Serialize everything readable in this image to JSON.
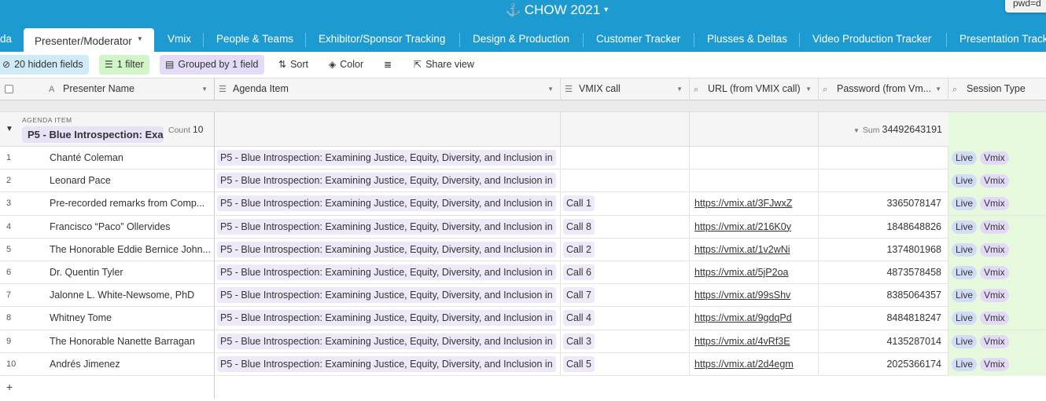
{
  "base": {
    "title": "CHOW 2021",
    "anchor_icon": "anchor-icon",
    "pwd_tooltip": "pwd=d"
  },
  "tabs": [
    {
      "label": "da"
    },
    {
      "label": "Presenter/Moderator",
      "active": true
    },
    {
      "label": "Vmix"
    },
    {
      "label": "People & Teams"
    },
    {
      "label": "Exhibitor/Sponsor Tracking"
    },
    {
      "label": "Design & Production"
    },
    {
      "label": "Customer Tracker"
    },
    {
      "label": "Plusses & Deltas"
    },
    {
      "label": "Video Production Tracker"
    },
    {
      "label": "Presentation Track"
    }
  ],
  "toolbar": {
    "hidden_fields": "20 hidden fields",
    "filter": "1 filter",
    "grouped": "Grouped by 1 field",
    "sort": "Sort",
    "color": "Color",
    "share": "Share view"
  },
  "columns": {
    "name": "Presenter Name",
    "agenda": "Agenda Item",
    "call": "VMIX call",
    "url": "URL (from VMIX call)",
    "password": "Password (from Vm...",
    "session": "Session Type"
  },
  "group": {
    "label": "AGENDA ITEM",
    "value": "P5 - Blue Introspection: Exa",
    "count_label": "Count",
    "count": "10",
    "sum_label": "Sum",
    "sum": "34492643191"
  },
  "rows": [
    {
      "num": "1",
      "name": "Chanté Coleman",
      "agenda": "P5 - Blue Introspection: Examining Justice, Equity, Diversity, and Inclusion in",
      "call": "",
      "url": "",
      "password": "",
      "tags": [
        "Live",
        "Vmix"
      ]
    },
    {
      "num": "2",
      "name": "Leonard Pace",
      "agenda": "P5 - Blue Introspection: Examining Justice, Equity, Diversity, and Inclusion in",
      "call": "",
      "url": "",
      "password": "",
      "tags": [
        "Live",
        "Vmix"
      ]
    },
    {
      "num": "3",
      "name": "Pre-recorded remarks from Comp...",
      "agenda": "P5 - Blue Introspection: Examining Justice, Equity, Diversity, and Inclusion in",
      "call": "Call 1",
      "url": "https://vmix.at/3FJwxZ",
      "password": "3365078147",
      "tags": [
        "Live",
        "Vmix"
      ]
    },
    {
      "num": "4",
      "name": "Francisco “Paco” Ollervides",
      "agenda": "P5 - Blue Introspection: Examining Justice, Equity, Diversity, and Inclusion in",
      "call": "Call 8",
      "url": "https://vmix.at/216K0y",
      "password": "1848648826",
      "tags": [
        "Live",
        "Vmix"
      ]
    },
    {
      "num": "5",
      "name": "The Honorable Eddie Bernice John...",
      "agenda": "P5 - Blue Introspection: Examining Justice, Equity, Diversity, and Inclusion in",
      "call": "Call 2",
      "url": "https://vmix.at/1v2wNi",
      "password": "1374801968",
      "tags": [
        "Live",
        "Vmix"
      ]
    },
    {
      "num": "6",
      "name": "Dr. Quentin Tyler",
      "agenda": "P5 - Blue Introspection: Examining Justice, Equity, Diversity, and Inclusion in",
      "call": "Call 6",
      "url": "https://vmix.at/5jP2oa",
      "password": "4873578458",
      "tags": [
        "Live",
        "Vmix"
      ]
    },
    {
      "num": "7",
      "name": "Jalonne L. White-Newsome,  PhD",
      "agenda": "P5 - Blue Introspection: Examining Justice, Equity, Diversity, and Inclusion in",
      "call": "Call 7",
      "url": "https://vmix.at/99sShv",
      "password": "8385064357",
      "tags": [
        "Live",
        "Vmix"
      ]
    },
    {
      "num": "8",
      "name": "Whitney Tome",
      "agenda": "P5 - Blue Introspection: Examining Justice, Equity, Diversity, and Inclusion in",
      "call": "Call 4",
      "url": "https://vmix.at/9gdqPd",
      "password": "8484818247",
      "tags": [
        "Live",
        "Vmix"
      ]
    },
    {
      "num": "9",
      "name": "The Honorable Nanette Barragan",
      "agenda": "P5 - Blue Introspection: Examining Justice, Equity, Diversity, and Inclusion in",
      "call": "Call 3",
      "url": "https://vmix.at/4vRf3E",
      "password": "4135287014",
      "tags": [
        "Live",
        "Vmix"
      ]
    },
    {
      "num": "10",
      "name": "Andrés Jimenez",
      "agenda": "P5 - Blue Introspection: Examining Justice, Equity, Diversity, and Inclusion in",
      "call": "Call 5",
      "url": "https://vmix.at/2d4egm",
      "password": "2025366174",
      "tags": [
        "Live",
        "Vmix"
      ]
    }
  ],
  "add_row": "+"
}
